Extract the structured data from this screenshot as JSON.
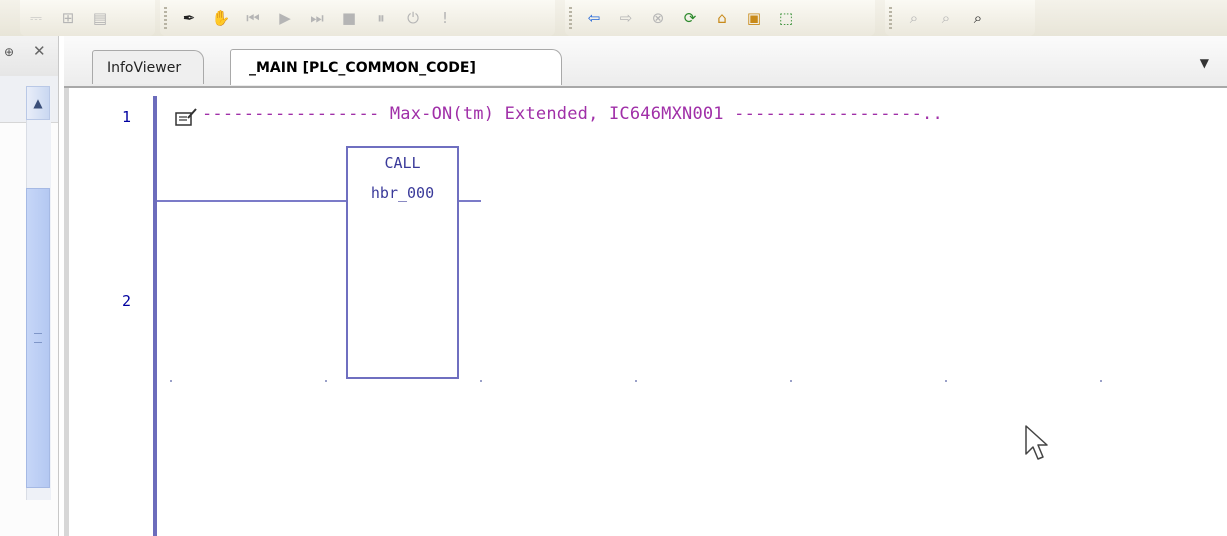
{
  "toolbar": {
    "groups": [
      [
        "new-rung-icon",
        "insert-icon",
        "table-icon"
      ],
      [
        "wand-icon",
        "hand-icon",
        "rewind-icon",
        "play-icon",
        "step-icon",
        "stop-icon",
        "pause-icon",
        "power-icon",
        "exclaim-icon"
      ],
      [
        "back-arrow-icon",
        "forward-arrow-icon",
        "cancel-icon",
        "refresh-icon",
        "home-icon",
        "module-icon",
        "chart-icon"
      ],
      [
        "find-icon",
        "find-next-icon",
        "find-replace-icon"
      ]
    ]
  },
  "tabs": {
    "inactive_label": "InfoViewer",
    "active_label": "_MAIN [PLC_COMMON_CODE]"
  },
  "editor": {
    "rung1_number": "1",
    "rung2_number": "2",
    "comment": "----------------- Max-ON(tm) Extended, IC646MXN001 ------------------..",
    "call_label": "CALL",
    "call_block_name": "hbr_000"
  },
  "colors": {
    "comment": "#a02fa8",
    "wire": "#7b7bc8",
    "rung_number": "#0000a0"
  }
}
